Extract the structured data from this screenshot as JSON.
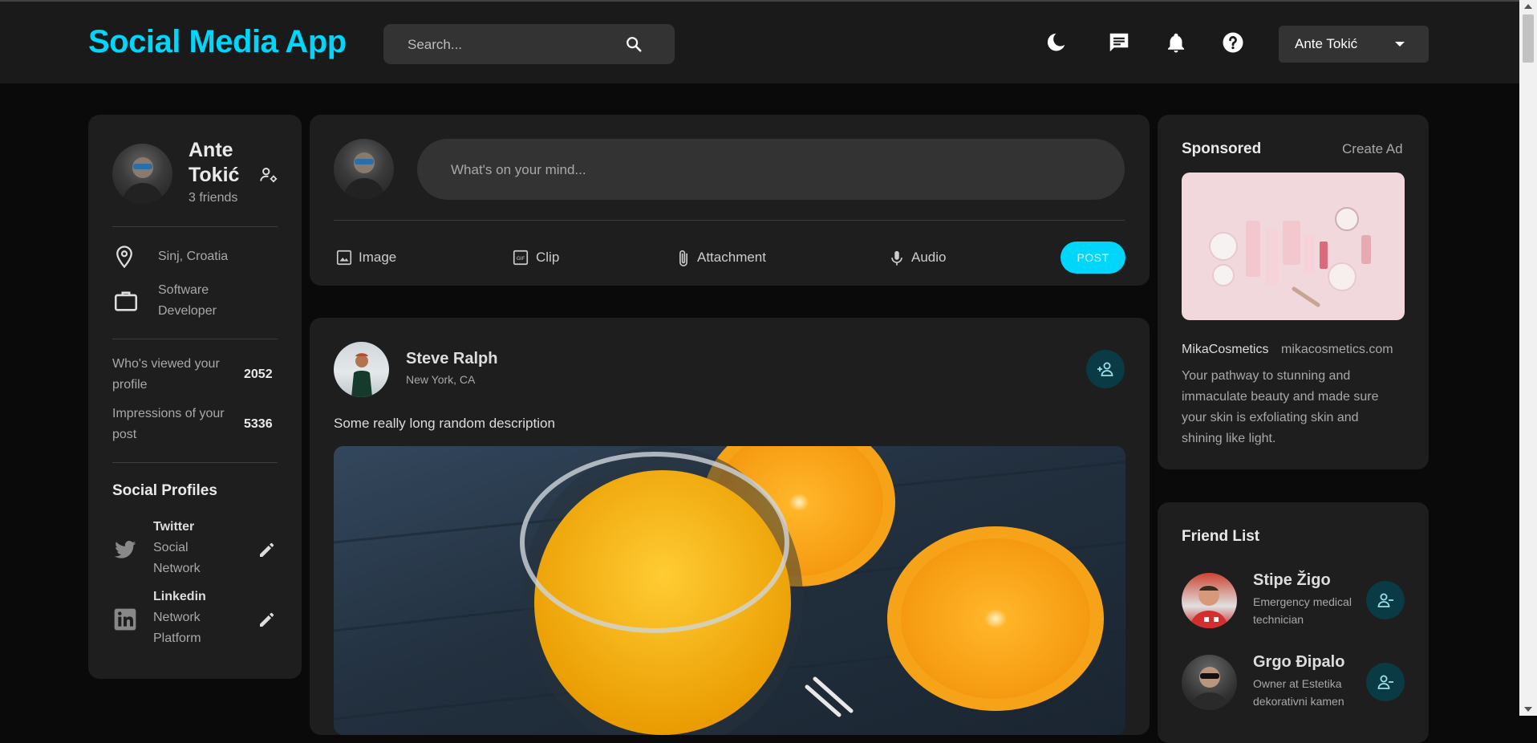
{
  "app": {
    "title": "Social Media App",
    "accent": "#00d5fa"
  },
  "navbar": {
    "search_placeholder": "Search...",
    "icons": [
      "dark-mode-icon",
      "message-icon",
      "notification-icon",
      "help-icon"
    ],
    "user_select": "Ante Tokić"
  },
  "profile": {
    "name_line1": "Ante",
    "name_line2": "Tokić",
    "friends": "3 friends",
    "location": "Sinj, Croatia",
    "occupation_line1": "Software",
    "occupation_line2": "Developer",
    "stats": [
      {
        "label_line1": "Who's viewed your",
        "label_line2": "profile",
        "value": "2052"
      },
      {
        "label_line1": "Impressions of your",
        "label_line2": "post",
        "value": "5336"
      }
    ],
    "social_title": "Social Profiles",
    "socials": [
      {
        "name": "Twitter",
        "desc_line1": "Social",
        "desc_line2": "Network",
        "icon": "twitter-icon"
      },
      {
        "name": "Linkedin",
        "desc_line1": "Network",
        "desc_line2": "Platform",
        "icon": "linkedin-icon"
      }
    ]
  },
  "composer": {
    "placeholder": "What's on your mind...",
    "actions": [
      "Image",
      "Clip",
      "Attachment",
      "Audio"
    ],
    "post_label": "POST"
  },
  "post": {
    "author": "Steve Ralph",
    "location": "New York, CA",
    "description": "Some really long random description"
  },
  "sponsored": {
    "title": "Sponsored",
    "create_ad": "Create Ad",
    "brand": "MikaCosmetics",
    "url": "mikacosmetics.com",
    "text_lines": [
      "Your pathway to stunning and",
      "immaculate beauty and made sure",
      "your skin is exfoliating skin and",
      "shining like light."
    ]
  },
  "friends": {
    "title": "Friend List",
    "items": [
      {
        "name": "Stipe Žigo",
        "desc_line1": "Emergency medical",
        "desc_line2": "technician"
      },
      {
        "name": "Grgo Đipalo",
        "desc_line1": "Owner at Estetika",
        "desc_line2": "dekorativni kamen"
      }
    ]
  }
}
